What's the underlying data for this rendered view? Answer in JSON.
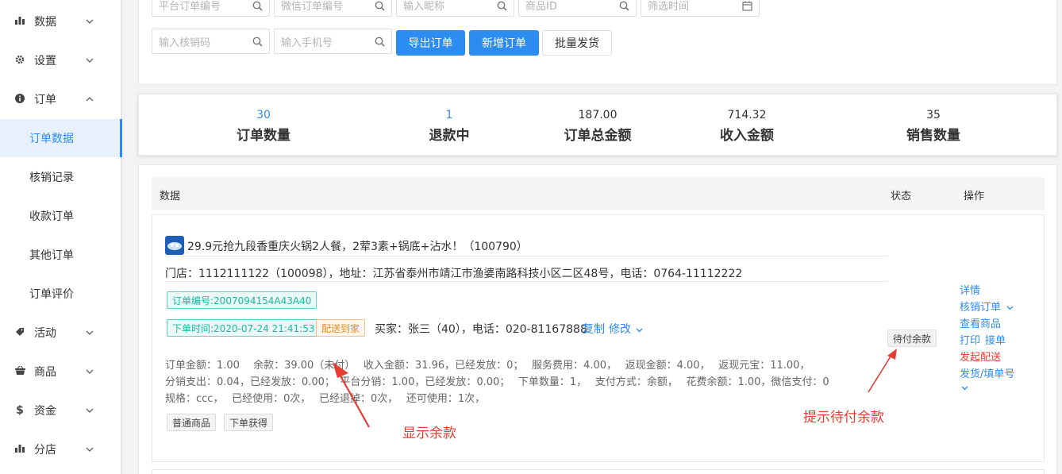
{
  "sidebar": {
    "items": [
      {
        "label": "数据",
        "icon": "bar-chart-icon"
      },
      {
        "label": "设置",
        "icon": "gear-icon"
      },
      {
        "label": "订单",
        "icon": "info-circle-icon"
      },
      {
        "label": "活动",
        "icon": "tag-icon"
      },
      {
        "label": "商品",
        "icon": "basket-icon"
      },
      {
        "label": "资金",
        "icon": "dollar-icon"
      },
      {
        "label": "分店",
        "icon": "bar-chart-icon"
      }
    ],
    "order_sub": [
      "订单数据",
      "核销记录",
      "收款订单",
      "其他订单",
      "订单评价"
    ]
  },
  "filters": {
    "platform_order_no": "平台订单编号",
    "wechat_order_no": "微信订单编号",
    "nickname": "输入昵称",
    "product_id": "商品ID",
    "filter_time": "筛选时间",
    "verify_code": "输入核销码",
    "phone": "输入手机号",
    "export_btn": "导出订单",
    "add_btn": "新增订单",
    "bulk_ship_btn": "批量发货"
  },
  "stats": [
    {
      "value": "30",
      "label": "订单数量"
    },
    {
      "value": "1",
      "label": "退款中"
    },
    {
      "value": "187.00",
      "label": "订单总金额"
    },
    {
      "value": "714.32",
      "label": "收入金额"
    },
    {
      "value": "35",
      "label": "销售数量"
    }
  ],
  "table": {
    "col_data": "数据",
    "col_status": "状态",
    "col_action": "操作"
  },
  "order": {
    "title": "29.9元抢九段香重庆火锅2人餐，2荤3素+锅底+沾水！（100790）",
    "store": "门店：1112111122（100098），地址：江苏省泰州市靖江市渔婆南路科技小区二区48号，电话：0764-11112222",
    "order_no": "订单编号:2007094154A43A40",
    "order_time": "下单时间:2020-07-24 21:41:53",
    "delivery_tag": "配送到家",
    "buyer": "买家：张三（40），电话：020-81167888",
    "copy": "复制",
    "edit": "修改",
    "line1": "订单金额：1.00　 余款：39.00（未付）　 收入金额：31.96，已经发放：0；　 服务费用：4.00，　 返现金额：4.00，　 返现元宝：11.00，",
    "line2": "分销支出：0.04，已经发放：0.00；　平台分销：1.00，已经发放：0.00；　 下单数量：1，　 支付方式：余额，　 花费余额：1.00，微信支付：0",
    "line3": "规格：ccc，　 已经使用：0次，　 已经退掉：0次，　 还可使用：1次，",
    "tags": [
      "普通商品",
      "下单获得"
    ],
    "status": "待付余款",
    "actions": {
      "detail": "详情",
      "verify": "核销订单",
      "view_goods": "查看商品",
      "print": "打印",
      "accept": "接单",
      "start_delivery": "发起配送",
      "ship": "发货/填单号"
    }
  },
  "annotations": {
    "balance": "显示余款",
    "pending": "提示待付余款"
  },
  "colors": {
    "primary": "#2d8cf0",
    "annotation": "#e43d33",
    "teal": "#19b9a4",
    "orange": "#f18a1f"
  }
}
